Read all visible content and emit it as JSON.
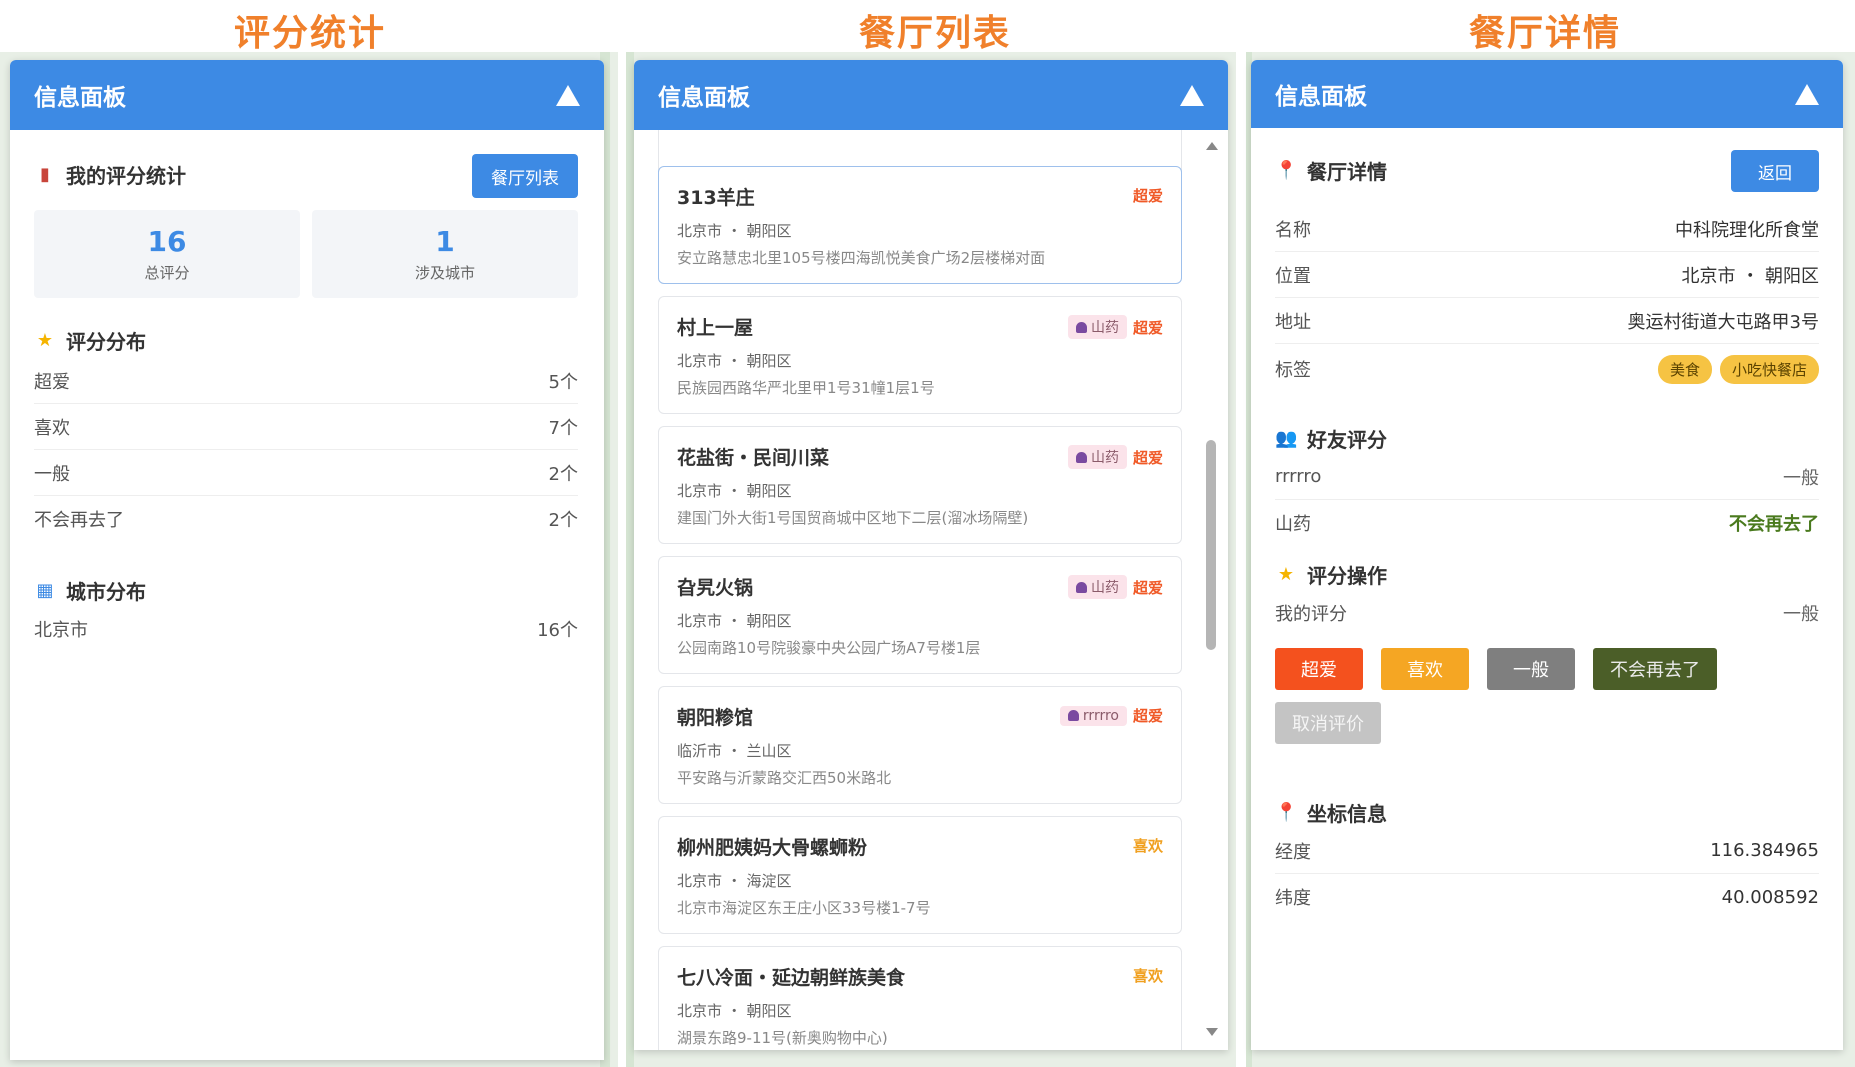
{
  "captions": [
    "评分统计",
    "餐厅列表",
    "餐厅详情"
  ],
  "panel_title": "信息面板",
  "stats": {
    "title": "我的评分统计",
    "list_button": "餐厅列表",
    "total": {
      "value": "16",
      "label": "总评分"
    },
    "cities": {
      "value": "1",
      "label": "涉及城市"
    },
    "dist_title": "评分分布",
    "dist": [
      {
        "label": "超爱",
        "count": "5个"
      },
      {
        "label": "喜欢",
        "count": "7个"
      },
      {
        "label": "一般",
        "count": "2个"
      },
      {
        "label": "不会再去了",
        "count": "2个"
      }
    ],
    "city_title": "城市分布",
    "cities_list": [
      {
        "label": "北京市",
        "count": "16个"
      }
    ]
  },
  "list": {
    "items": [
      {
        "name": "313羊庄",
        "loc": "北京市 ・ 朝阳区",
        "addr": "安立路慧忠北里105号楼四海凯悦美食广场2层楼梯对面",
        "friend": "",
        "rating": "超爱",
        "rating_color": "#f05a28"
      },
      {
        "name": "村上一屋",
        "loc": "北京市 ・ 朝阳区",
        "addr": "民族园西路华严北里甲1号31幢1层1号",
        "friend": "山药",
        "rating": "超爱",
        "rating_color": "#f05a28"
      },
      {
        "name": "花盐街・民间川菜",
        "loc": "北京市 ・ 朝阳区",
        "addr": "建国门外大街1号国贸商城中区地下二层(溜冰场隔壁)",
        "friend": "山药",
        "rating": "超爱",
        "rating_color": "#f05a28"
      },
      {
        "name": "旮旯火锅",
        "loc": "北京市 ・ 朝阳区",
        "addr": "公园南路10号院骏豪中央公园广场A7号楼1层",
        "friend": "山药",
        "rating": "超爱",
        "rating_color": "#f05a28"
      },
      {
        "name": "朝阳糁馆",
        "loc": "临沂市 ・ 兰山区",
        "addr": "平安路与沂蒙路交汇西50米路北",
        "friend": "rrrrro",
        "rating": "超爱",
        "rating_color": "#f05a28"
      },
      {
        "name": "柳州肥姨妈大骨螺蛳粉",
        "loc": "北京市 ・ 海淀区",
        "addr": "北京市海淀区东王庄小区33号楼1-7号",
        "friend": "",
        "rating": "喜欢",
        "rating_color": "#f0a020"
      },
      {
        "name": "七八冷面・延边朝鲜族美食",
        "loc": "北京市 ・ 朝阳区",
        "addr": "湖景东路9-11号(新奥购物中心)",
        "friend": "",
        "rating": "喜欢",
        "rating_color": "#f0a020"
      }
    ]
  },
  "detail": {
    "title": "餐厅详情",
    "back_button": "返回",
    "fields": [
      {
        "label": "名称",
        "value": "中科院理化所食堂"
      },
      {
        "label": "位置",
        "value": "北京市 ・ 朝阳区"
      },
      {
        "label": "地址",
        "value": "奥运村街道大屯路甲3号"
      }
    ],
    "tags_label": "标签",
    "tags": [
      "美食",
      "小吃快餐店"
    ],
    "friends_title": "好友评分",
    "friends": [
      {
        "name": "rrrrro",
        "rating": "一般",
        "color": "#666666"
      },
      {
        "name": "山药",
        "rating": "不会再去了",
        "color": "#4a7a1e"
      }
    ],
    "action_title": "评分操作",
    "my_rating_label": "我的评分",
    "my_rating_value": "一般",
    "buttons": [
      {
        "label": "超爱",
        "color": "#f4511e"
      },
      {
        "label": "喜欢",
        "color": "#f5a623"
      },
      {
        "label": "一般",
        "color": "#7f7f7f"
      },
      {
        "label": "不会再去了",
        "color": "#4b5e28"
      }
    ],
    "cancel_button": "取消评价",
    "coord_title": "坐标信息",
    "coords": [
      {
        "label": "经度",
        "value": "116.384965"
      },
      {
        "label": "纬度",
        "value": "40.008592"
      }
    ]
  },
  "colors": {
    "header": "#3d8ae4",
    "caption": "#f0802b"
  }
}
